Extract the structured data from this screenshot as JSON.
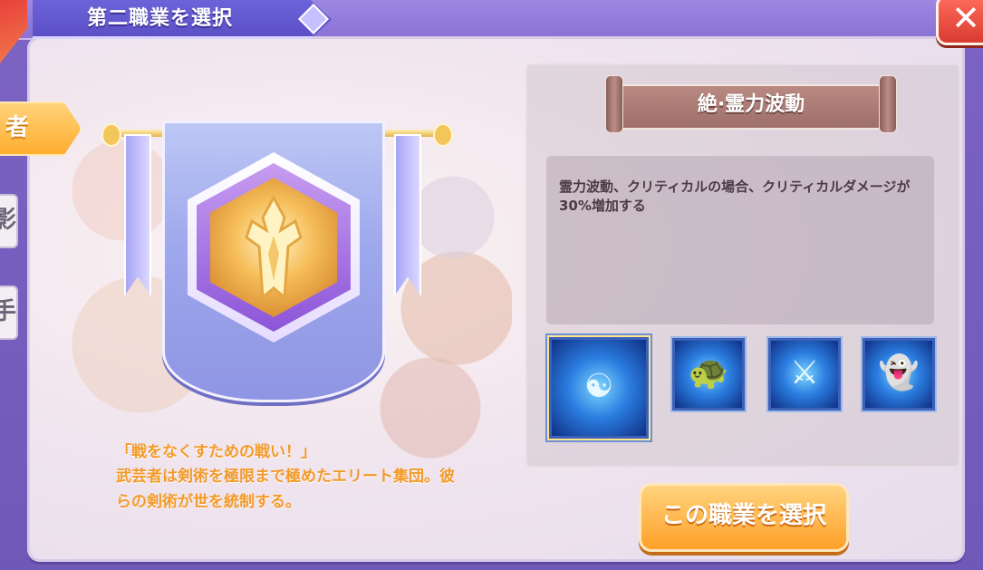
{
  "header": {
    "title": "第二職業を選択",
    "close_label": "✕"
  },
  "side_tabs": [
    {
      "label": "者",
      "active": true
    },
    {
      "label": "影",
      "active": false
    },
    {
      "label": "手",
      "active": false
    }
  ],
  "job": {
    "quote": "「戦をなくすための戦い！」",
    "description": "武芸者は剣術を極限まで極めたエリート集団。彼らの剣術が世を統制する。"
  },
  "skill_panel": {
    "skill_name": "絶·霊力波動",
    "skill_description": "霊力波動、クリティカルの場合、クリティカルダメージが30%増加する",
    "skills": [
      {
        "icon": "spirit-wave-icon",
        "selected": true
      },
      {
        "icon": "turtle-icon",
        "selected": false
      },
      {
        "icon": "blade-slash-icon",
        "selected": false
      },
      {
        "icon": "ghost-icon",
        "selected": false
      }
    ]
  },
  "actions": {
    "select_label": "この職業を選択"
  },
  "colors": {
    "accent": "#ffa028",
    "panel": "#f1e6ee",
    "header": "#5b50c6"
  }
}
